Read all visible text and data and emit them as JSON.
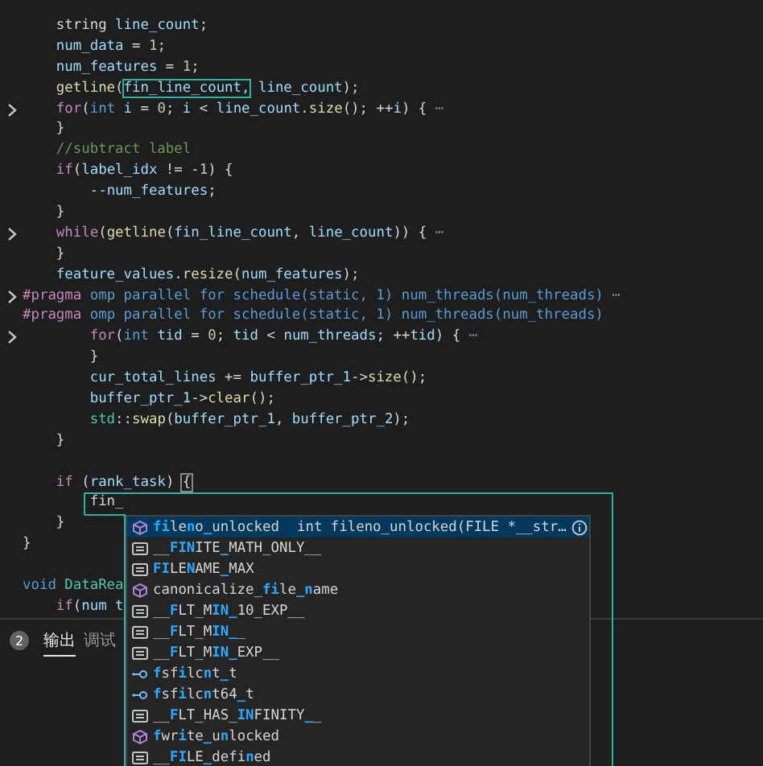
{
  "editor": {
    "lines": [
      {
        "folded": false,
        "tokens": [
          {
            "text": "    string ",
            "kind": "plain"
          },
          {
            "text": "line_count",
            "kind": "var"
          },
          {
            "text": ";",
            "kind": "plain"
          }
        ]
      },
      {
        "folded": false,
        "tokens": [
          {
            "text": "    num_data",
            "kind": "var"
          },
          {
            "text": " = ",
            "kind": "plain"
          },
          {
            "text": "1",
            "kind": "num"
          },
          {
            "text": ";",
            "kind": "plain"
          }
        ]
      },
      {
        "folded": false,
        "tokens": [
          {
            "text": "    num_features",
            "kind": "var"
          },
          {
            "text": " = ",
            "kind": "plain"
          },
          {
            "text": "1",
            "kind": "num"
          },
          {
            "text": ";",
            "kind": "plain"
          }
        ]
      },
      {
        "folded": false,
        "tokens": [
          {
            "text": "    getline",
            "kind": "fn"
          },
          {
            "text": "(",
            "kind": "plain"
          },
          {
            "text": "fin_line_count,",
            "kind": "match"
          },
          {
            "text": " line_count",
            "kind": "var"
          },
          {
            "text": ");",
            "kind": "plain"
          }
        ]
      },
      {
        "folded": true,
        "tokens": [
          {
            "text": "    for",
            "kind": "kw"
          },
          {
            "text": "(",
            "kind": "plain"
          },
          {
            "text": "int ",
            "kind": "type"
          },
          {
            "text": "i",
            "kind": "var"
          },
          {
            "text": " = ",
            "kind": "plain"
          },
          {
            "text": "0",
            "kind": "num"
          },
          {
            "text": "; ",
            "kind": "plain"
          },
          {
            "text": "i",
            "kind": "var"
          },
          {
            "text": " < ",
            "kind": "plain"
          },
          {
            "text": "line_count",
            "kind": "var"
          },
          {
            "text": ".",
            "kind": "plain"
          },
          {
            "text": "size",
            "kind": "fn"
          },
          {
            "text": "(); ++",
            "kind": "plain"
          },
          {
            "text": "i",
            "kind": "var"
          },
          {
            "text": ") { ",
            "kind": "plain"
          },
          {
            "text": "⋯",
            "kind": "ellipsis"
          }
        ]
      },
      {
        "folded": false,
        "tokens": [
          {
            "text": "    }",
            "kind": "plain"
          }
        ]
      },
      {
        "folded": false,
        "tokens": [
          {
            "text": "    //subtract label",
            "kind": "comment"
          }
        ]
      },
      {
        "folded": false,
        "tokens": [
          {
            "text": "    if",
            "kind": "kw"
          },
          {
            "text": "(",
            "kind": "plain"
          },
          {
            "text": "label_idx",
            "kind": "var"
          },
          {
            "text": " != -",
            "kind": "plain"
          },
          {
            "text": "1",
            "kind": "num"
          },
          {
            "text": ") {",
            "kind": "plain"
          }
        ]
      },
      {
        "folded": false,
        "tokens": [
          {
            "text": "        --",
            "kind": "plain"
          },
          {
            "text": "num_features",
            "kind": "var"
          },
          {
            "text": ";",
            "kind": "plain"
          }
        ]
      },
      {
        "folded": false,
        "tokens": [
          {
            "text": "    }",
            "kind": "plain"
          }
        ]
      },
      {
        "folded": true,
        "tokens": [
          {
            "text": "    while",
            "kind": "kw"
          },
          {
            "text": "(",
            "kind": "plain"
          },
          {
            "text": "getline",
            "kind": "fn"
          },
          {
            "text": "(",
            "kind": "plain"
          },
          {
            "text": "fin_line_count",
            "kind": "var"
          },
          {
            "text": ", ",
            "kind": "plain"
          },
          {
            "text": "line_count",
            "kind": "var"
          },
          {
            "text": ")) { ",
            "kind": "plain"
          },
          {
            "text": "⋯",
            "kind": "ellipsis"
          }
        ]
      },
      {
        "folded": false,
        "tokens": [
          {
            "text": "    }",
            "kind": "plain"
          }
        ]
      },
      {
        "folded": false,
        "tokens": [
          {
            "text": "    feature_values",
            "kind": "var"
          },
          {
            "text": ".",
            "kind": "plain"
          },
          {
            "text": "resize",
            "kind": "fn"
          },
          {
            "text": "(",
            "kind": "plain"
          },
          {
            "text": "num_features",
            "kind": "var"
          },
          {
            "text": ");",
            "kind": "plain"
          }
        ]
      },
      {
        "folded": true,
        "tokens": [
          {
            "text": "#pragma",
            "kind": "macro"
          },
          {
            "text": " omp parallel for schedule(static, 1) num_threads(num_threads) ",
            "kind": "type"
          },
          {
            "text": "⋯",
            "kind": "ellipsis"
          }
        ]
      },
      {
        "folded": false,
        "tokens": [
          {
            "text": "#pragma",
            "kind": "macro"
          },
          {
            "text": " omp parallel for schedule(static, 1) num_threads(num_threads)",
            "kind": "type"
          }
        ]
      },
      {
        "folded": true,
        "tokens": [
          {
            "text": "        for",
            "kind": "kw"
          },
          {
            "text": "(",
            "kind": "plain"
          },
          {
            "text": "int ",
            "kind": "type"
          },
          {
            "text": "tid",
            "kind": "var"
          },
          {
            "text": " = ",
            "kind": "plain"
          },
          {
            "text": "0",
            "kind": "num"
          },
          {
            "text": "; ",
            "kind": "plain"
          },
          {
            "text": "tid",
            "kind": "var"
          },
          {
            "text": " < ",
            "kind": "plain"
          },
          {
            "text": "num_threads",
            "kind": "var"
          },
          {
            "text": "; ++",
            "kind": "plain"
          },
          {
            "text": "tid",
            "kind": "var"
          },
          {
            "text": ") { ",
            "kind": "plain"
          },
          {
            "text": "⋯",
            "kind": "ellipsis"
          }
        ]
      },
      {
        "folded": false,
        "tokens": [
          {
            "text": "        }",
            "kind": "plain"
          }
        ]
      },
      {
        "folded": false,
        "tokens": [
          {
            "text": "        cur_total_lines",
            "kind": "var"
          },
          {
            "text": " += ",
            "kind": "plain"
          },
          {
            "text": "buffer_ptr_1",
            "kind": "var"
          },
          {
            "text": "->",
            "kind": "plain"
          },
          {
            "text": "size",
            "kind": "fn"
          },
          {
            "text": "();",
            "kind": "plain"
          }
        ]
      },
      {
        "folded": false,
        "tokens": [
          {
            "text": "        buffer_ptr_1",
            "kind": "var"
          },
          {
            "text": "->",
            "kind": "plain"
          },
          {
            "text": "clear",
            "kind": "fn"
          },
          {
            "text": "();",
            "kind": "plain"
          }
        ]
      },
      {
        "folded": false,
        "tokens": [
          {
            "text": "        std",
            "kind": "ns"
          },
          {
            "text": "::",
            "kind": "plain"
          },
          {
            "text": "swap",
            "kind": "fn"
          },
          {
            "text": "(",
            "kind": "plain"
          },
          {
            "text": "buffer_ptr_1",
            "kind": "var"
          },
          {
            "text": ", ",
            "kind": "plain"
          },
          {
            "text": "buffer_ptr_2",
            "kind": "var"
          },
          {
            "text": ");",
            "kind": "plain"
          }
        ]
      },
      {
        "folded": false,
        "blank_after": true,
        "tokens": [
          {
            "text": "    }",
            "kind": "plain"
          }
        ]
      },
      {
        "folded": false,
        "tokens": [
          {
            "text": "    if",
            "kind": "kw"
          },
          {
            "text": " (",
            "kind": "plain"
          },
          {
            "text": "rank_task",
            "kind": "var"
          },
          {
            "text": ") ",
            "kind": "plain"
          },
          {
            "text": "{",
            "kind": "bracket"
          }
        ]
      },
      {
        "folded": false,
        "tokens": [
          {
            "text": "        fin_",
            "kind": "plain"
          }
        ]
      },
      {
        "folded": false,
        "tokens": [
          {
            "text": "    }",
            "kind": "plain"
          }
        ]
      },
      {
        "folded": false,
        "blank_after": true,
        "tokens": [
          {
            "text": "}",
            "kind": "plain"
          }
        ]
      },
      {
        "folded": false,
        "tokens": [
          {
            "text": "void ",
            "kind": "type"
          },
          {
            "text": "DataRea",
            "kind": "ns"
          }
        ]
      },
      {
        "folded": false,
        "tokens": [
          {
            "text": "    if",
            "kind": "kw"
          },
          {
            "text": "(",
            "kind": "plain"
          },
          {
            "text": "num t",
            "kind": "var"
          }
        ]
      }
    ]
  },
  "panel": {
    "badge": "2",
    "tabs": [
      {
        "label": "输出",
        "selected": true
      },
      {
        "label": "调试",
        "selected": false
      }
    ]
  },
  "suggestions": [
    {
      "kind": "method",
      "selected": true,
      "label": "**fi**le**n**o**_**unlocked",
      "detail": "int fileno_unlocked(FILE *__str…"
    },
    {
      "kind": "constant",
      "selected": false,
      "label": "__**FIN**ITE**_**MATH_ONLY__"
    },
    {
      "kind": "constant",
      "selected": false,
      "label": "**FI**LE**N**AME**_**MAX"
    },
    {
      "kind": "method",
      "selected": false,
      "label": "canonicalize_**fi**le**_n**ame"
    },
    {
      "kind": "constant",
      "selected": false,
      "label": "__**F**LT_M**IN_**10_EXP__"
    },
    {
      "kind": "constant",
      "selected": false,
      "label": "__**F**LT_M**IN_**_"
    },
    {
      "kind": "constant",
      "selected": false,
      "label": "__**F**LT_M**IN_**EXP__"
    },
    {
      "kind": "typedef",
      "selected": false,
      "label": "**f**sf**i**lc**n**t**_**t"
    },
    {
      "kind": "typedef",
      "selected": false,
      "label": "**f**sf**i**lc**n**t64**_**t"
    },
    {
      "kind": "constant",
      "selected": false,
      "label": "__**F**LT_HAS_**IN**FINITY**_**_"
    },
    {
      "kind": "method",
      "selected": false,
      "label": "**f**wr**i**te**_**u**n**locked"
    },
    {
      "kind": "constant",
      "selected": false,
      "label": "__**FI**LE**_**defi**n**ed"
    }
  ]
}
